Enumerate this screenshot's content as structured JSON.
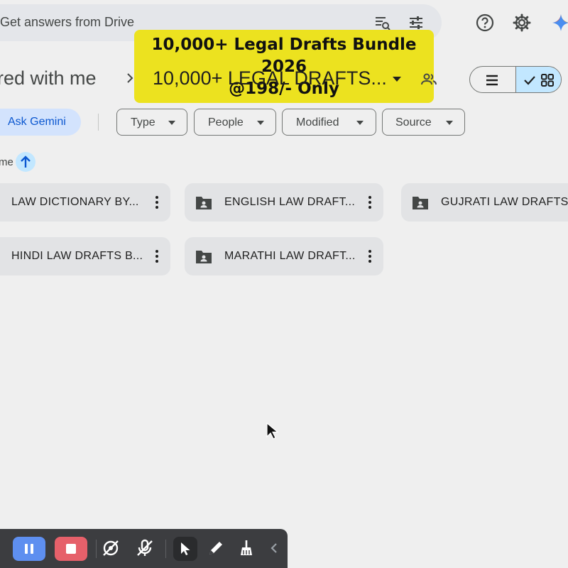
{
  "search": {
    "placeholder": "Get answers from Drive"
  },
  "banner": {
    "line1": "10,000+ Legal Drafts Bundle 2026",
    "line2": "@198/- Only"
  },
  "breadcrumb": {
    "root": "red with me",
    "folder": "10,000+ LEGAL DRAFTS..."
  },
  "filters": {
    "ask_gemini": "Ask Gemini",
    "chips": [
      "Type",
      "People",
      "Modified",
      "Source"
    ]
  },
  "sort": {
    "label": "me"
  },
  "folders": [
    "LAW DICTIONARY BY...",
    "ENGLISH LAW DRAFT...",
    "GUJRATI LAW DRAFTS...",
    "HINDI LAW DRAFTS B...",
    "MARATHI LAW DRAFT..."
  ],
  "colors": {
    "accent": "#0b57d0",
    "selected_bg": "#c2e7ff",
    "banner_bg": "#ece21f",
    "card_bg": "#e2e3e5"
  },
  "icons": [
    "search-tune-icon",
    "filter-icon",
    "help-icon",
    "settings-icon",
    "gemini-icon",
    "chevron-right-icon",
    "caret-down-icon",
    "shared-people-icon",
    "list-view-icon",
    "check-icon",
    "grid-view-icon",
    "arrow-up-icon",
    "shared-folder-icon",
    "more-vert-icon",
    "pause-icon",
    "stop-icon",
    "camera-off-icon",
    "mic-off-icon",
    "cursor-icon",
    "pen-icon",
    "eraser-icon",
    "collapse-icon"
  ]
}
